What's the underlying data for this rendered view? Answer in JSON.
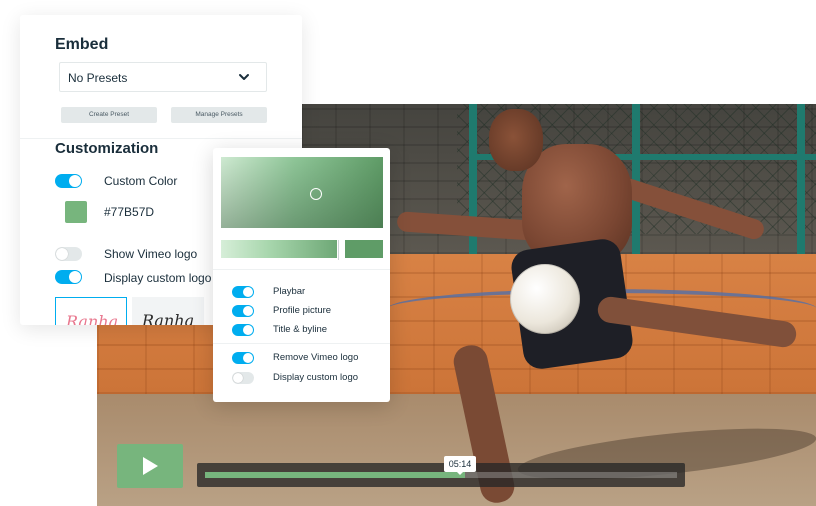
{
  "embed": {
    "title": "Embed",
    "preset_value": "No Presets",
    "create_preset_label": "Create Preset",
    "manage_presets_label": "Manage Presets"
  },
  "customization": {
    "title": "Customization",
    "custom_color_label": "Custom Color",
    "custom_color_on": true,
    "color_hex": "#77B57D",
    "show_vimeo_logo_label": "Show Vimeo logo",
    "show_vimeo_logo_on": false,
    "display_custom_logo_label": "Display custom logo",
    "display_custom_logo_on": true,
    "logo_options": [
      "Ranha",
      "Ranha"
    ]
  },
  "options_popover": {
    "items": [
      {
        "label": "Playbar",
        "on": true
      },
      {
        "label": "Profile picture",
        "on": true
      },
      {
        "label": "Title & byline",
        "on": true
      },
      {
        "label": "Remove Vimeo logo",
        "on": true
      },
      {
        "label": "Display custom logo",
        "on": false
      }
    ]
  },
  "player": {
    "timestamp": "05:14",
    "progress_fraction": 0.55
  },
  "colors": {
    "accent": "#77B57D",
    "toggle_on": "#00ADEF",
    "toggle_off": "#E3E8E9",
    "text": "#1A2E3B"
  },
  "icons": {
    "play": "play-icon",
    "chevron": "chevron-down-icon"
  }
}
